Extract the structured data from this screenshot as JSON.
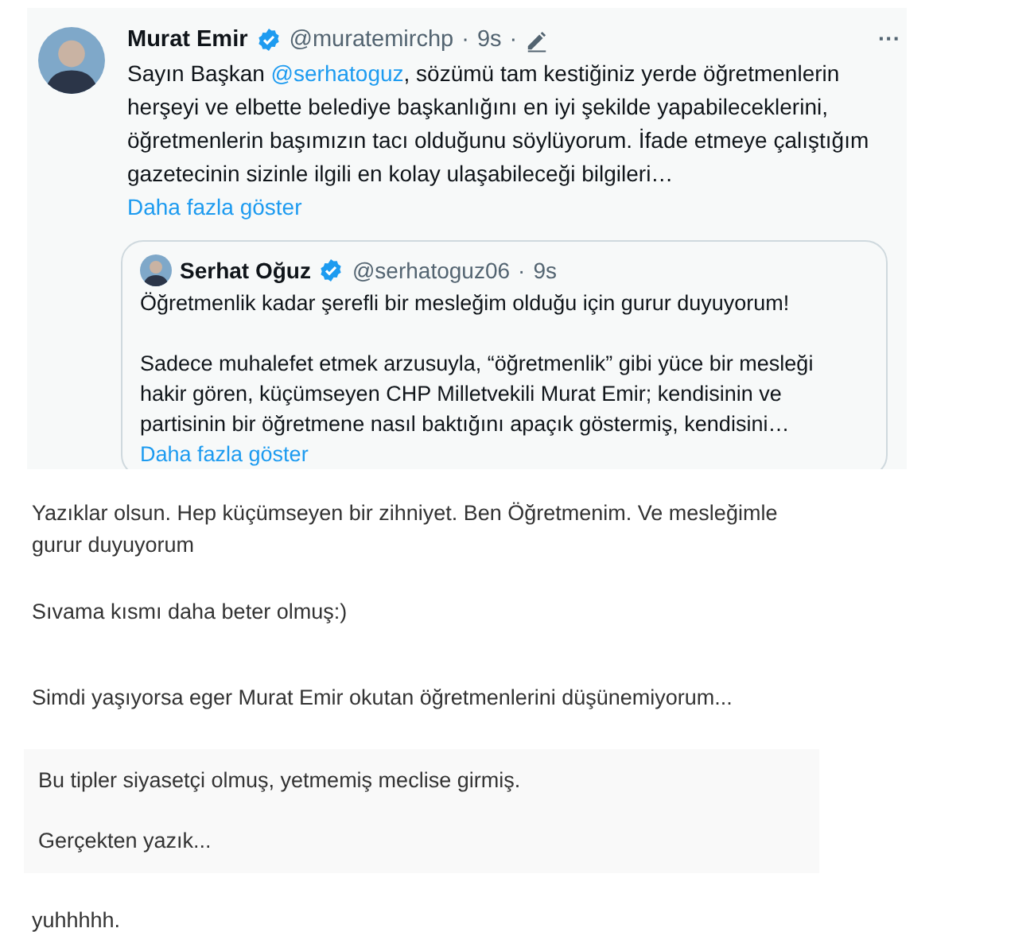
{
  "tweet": {
    "author": "Murat Emir",
    "verified": true,
    "handle": "@muratemirchp",
    "separator": "·",
    "time": "9s",
    "edited": true,
    "more": "···",
    "text_before": "Sayın Başkan ",
    "mention": "@serhatoguz",
    "text_after": ", sözümü tam kestiğiniz yerde öğretmenlerin herşeyi ve elbette belediye başkanlığını en iyi şekilde yapabileceklerini, öğretmenlerin başımızın tacı olduğunu söylüyorum. İfade etmeye çalıştığım gazetecinin sizinle ilgili en kolay ulaşabileceği bilgileri…",
    "show_more": "Daha fazla göster",
    "quote": {
      "author": "Serhat Oğuz",
      "verified": true,
      "handle": "@serhatoguz06",
      "separator": "·",
      "time": "9s",
      "paragraphs": [
        "Öğretmenlik kadar şerefli bir mesleğim olduğu için gurur duyuyorum!",
        "Sadece muhalefet etmek arzusuyla, “öğretmenlik” gibi yüce bir mesleği hakir gören, küçümseyen CHP Milletvekili Murat Emir; kendisinin ve partisinin bir öğretmene nasıl baktığını apaçık  göstermiş, kendisini…"
      ],
      "show_more": "Daha fazla göster"
    }
  },
  "comments": [
    {
      "kind": "plain",
      "paragraphs": [
        "Yazıklar olsun. Hep küçümseyen bir zihniyet. Ben Öğretmenim. Ve mesleğimle gurur duyuyorum"
      ]
    },
    {
      "kind": "plain",
      "paragraphs": [
        "Sıvama kısmı daha beter olmuş:)"
      ]
    },
    {
      "kind": "plain",
      "paragraphs": [
        "Simdi yaşıyorsa eger Murat Emir okutan  öğretmenlerini düşünemiyorum..."
      ]
    },
    {
      "kind": "boxed",
      "paragraphs": [
        "Bu tipler siyasetçi olmuş, yetmemiş meclise girmiş.",
        "Gerçekten yazık..."
      ]
    },
    {
      "kind": "plain",
      "paragraphs": [
        "yuhhhhh."
      ]
    }
  ]
}
